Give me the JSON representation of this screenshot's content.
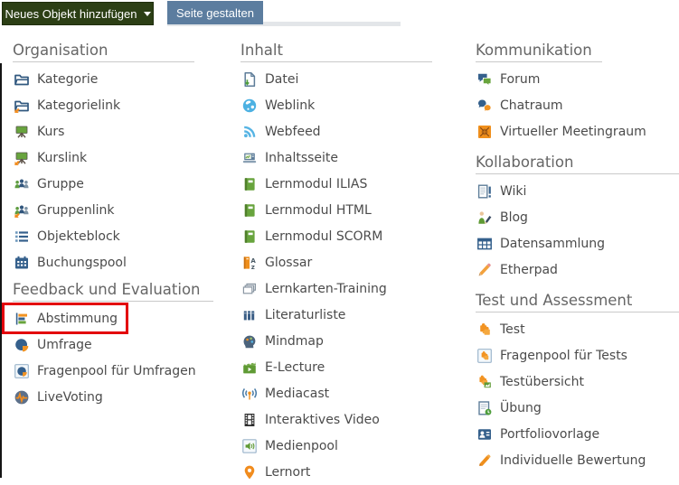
{
  "toolbar": {
    "add_object_button": "Neues Objekt hinzufügen",
    "page_design_button": "Seite gestalten"
  },
  "colors": {
    "add_button_bg": "#2c3f15",
    "page_design_button_bg": "#5c7d9f",
    "highlight_border": "#e3000b"
  },
  "menu": {
    "columns": [
      {
        "sections": [
          {
            "title": "Organisation",
            "items": [
              {
                "label": "Kategorie",
                "icon": "category-icon"
              },
              {
                "label": "Kategorielink",
                "icon": "category-link-icon"
              },
              {
                "label": "Kurs",
                "icon": "course-icon"
              },
              {
                "label": "Kurslink",
                "icon": "course-link-icon"
              },
              {
                "label": "Gruppe",
                "icon": "group-icon"
              },
              {
                "label": "Gruppenlink",
                "icon": "group-link-icon"
              },
              {
                "label": "Objekteblock",
                "icon": "item-group-icon"
              },
              {
                "label": "Buchungspool",
                "icon": "booking-pool-icon"
              }
            ]
          },
          {
            "title": "Feedback und Evaluation",
            "items": [
              {
                "label": "Abstimmung",
                "icon": "poll-icon",
                "highlighted": true
              },
              {
                "label": "Umfrage",
                "icon": "survey-icon"
              },
              {
                "label": "Fragenpool für Umfragen",
                "icon": "survey-question-pool-icon"
              },
              {
                "label": "LiveVoting",
                "icon": "live-voting-icon"
              }
            ]
          }
        ]
      },
      {
        "sections": [
          {
            "title": "Inhalt",
            "items": [
              {
                "label": "Datei",
                "icon": "file-icon"
              },
              {
                "label": "Weblink",
                "icon": "weblink-icon"
              },
              {
                "label": "Webfeed",
                "icon": "webfeed-icon"
              },
              {
                "label": "Inhaltsseite",
                "icon": "content-page-icon"
              },
              {
                "label": "Lernmodul ILIAS",
                "icon": "learning-module-icon"
              },
              {
                "label": "Lernmodul HTML",
                "icon": "learning-module-icon"
              },
              {
                "label": "Lernmodul SCORM",
                "icon": "learning-module-icon"
              },
              {
                "label": "Glossar",
                "icon": "glossary-icon"
              },
              {
                "label": "Lernkarten-Training",
                "icon": "flashcards-icon"
              },
              {
                "label": "Literaturliste",
                "icon": "bibliography-icon"
              },
              {
                "label": "Mindmap",
                "icon": "mindmap-icon"
              },
              {
                "label": "E-Lecture",
                "icon": "e-lecture-icon"
              },
              {
                "label": "Mediacast",
                "icon": "mediacast-icon"
              },
              {
                "label": "Interaktives Video",
                "icon": "interactive-video-icon"
              },
              {
                "label": "Medienpool",
                "icon": "media-pool-icon"
              },
              {
                "label": "Lernort",
                "icon": "learning-location-icon"
              }
            ]
          }
        ]
      },
      {
        "sections": [
          {
            "title": "Kommunikation",
            "items": [
              {
                "label": "Forum",
                "icon": "forum-icon"
              },
              {
                "label": "Chatraum",
                "icon": "chat-icon"
              },
              {
                "label": "Virtueller Meetingraum",
                "icon": "meeting-room-icon"
              }
            ]
          },
          {
            "title": "Kollaboration",
            "items": [
              {
                "label": "Wiki",
                "icon": "wiki-icon"
              },
              {
                "label": "Blog",
                "icon": "blog-icon"
              },
              {
                "label": "Datensammlung",
                "icon": "data-collection-icon"
              },
              {
                "label": "Etherpad",
                "icon": "etherpad-icon"
              }
            ]
          },
          {
            "title": "Test und Assessment",
            "items": [
              {
                "label": "Test",
                "icon": "test-icon"
              },
              {
                "label": "Fragenpool für Tests",
                "icon": "test-question-pool-icon"
              },
              {
                "label": "Testübersicht",
                "icon": "test-overview-icon"
              },
              {
                "label": "Übung",
                "icon": "exercise-icon"
              },
              {
                "label": "Portfoliovorlage",
                "icon": "portfolio-template-icon"
              },
              {
                "label": "Individuelle Bewertung",
                "icon": "individual-assessment-icon"
              }
            ]
          }
        ]
      }
    ]
  }
}
